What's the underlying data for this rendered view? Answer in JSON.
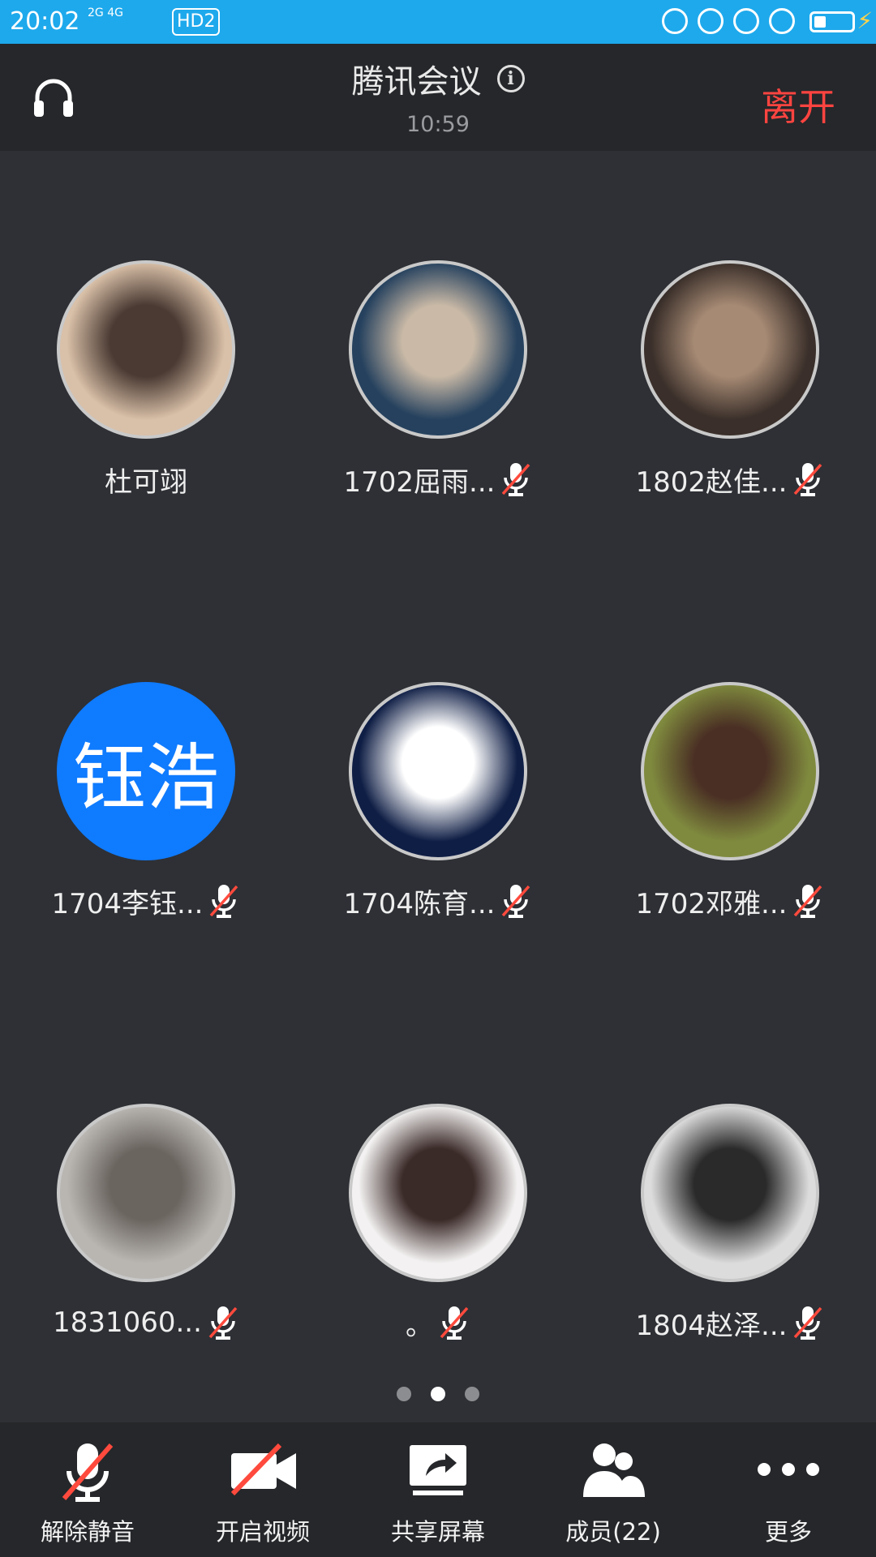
{
  "status_bar": {
    "time": "20:02",
    "network": "2G 4G",
    "hd": "HD2"
  },
  "header": {
    "title": "腾讯会议",
    "duration": "10:59",
    "leave": "离开"
  },
  "participants": [
    {
      "name": "杜可翊",
      "muted": false,
      "avatar": "photo-girl",
      "colors": [
        "#d9c0a8",
        "#4a3a33"
      ]
    },
    {
      "name": "1702屈雨...",
      "muted": true,
      "avatar": "photo-man-suit",
      "colors": [
        "#25415e",
        "#c9b9a6"
      ]
    },
    {
      "name": "1802赵佳...",
      "muted": true,
      "avatar": "photo-man-dark",
      "colors": [
        "#3a2f2a",
        "#a68a74"
      ]
    },
    {
      "name": "1704李钰...",
      "muted": true,
      "avatar": "text",
      "avatar_text": "钰浩",
      "colors": [
        "#0f7bff",
        "#0f7bff"
      ]
    },
    {
      "name": "1704陈育...",
      "muted": true,
      "avatar": "cartoon-cat",
      "colors": [
        "#0f1e45",
        "#ffffff"
      ]
    },
    {
      "name": "1702邓雅...",
      "muted": true,
      "avatar": "photo-woman-field",
      "colors": [
        "#7f8a3e",
        "#4a2f24"
      ]
    },
    {
      "name": "1831060...",
      "muted": true,
      "avatar": "photo-cat",
      "colors": [
        "#b9b6b2",
        "#6b6560"
      ]
    },
    {
      "name": "。",
      "muted": true,
      "avatar": "cartoon-boy",
      "colors": [
        "#f3f1f1",
        "#3a2a28"
      ]
    },
    {
      "name": "1804赵泽...",
      "muted": true,
      "avatar": "photo-woman-bw",
      "colors": [
        "#dcdcdc",
        "#2a2a2a"
      ]
    }
  ],
  "pagination": {
    "pages": 3,
    "current": 2
  },
  "toolbar": {
    "unmute": "解除静音",
    "video": "开启视频",
    "share": "共享屏幕",
    "members": "成员(22)",
    "more": "更多"
  },
  "colors": {
    "accent": "#1ea9ec",
    "leave": "#ff4440",
    "muted_slash": "#ff4a3d"
  }
}
